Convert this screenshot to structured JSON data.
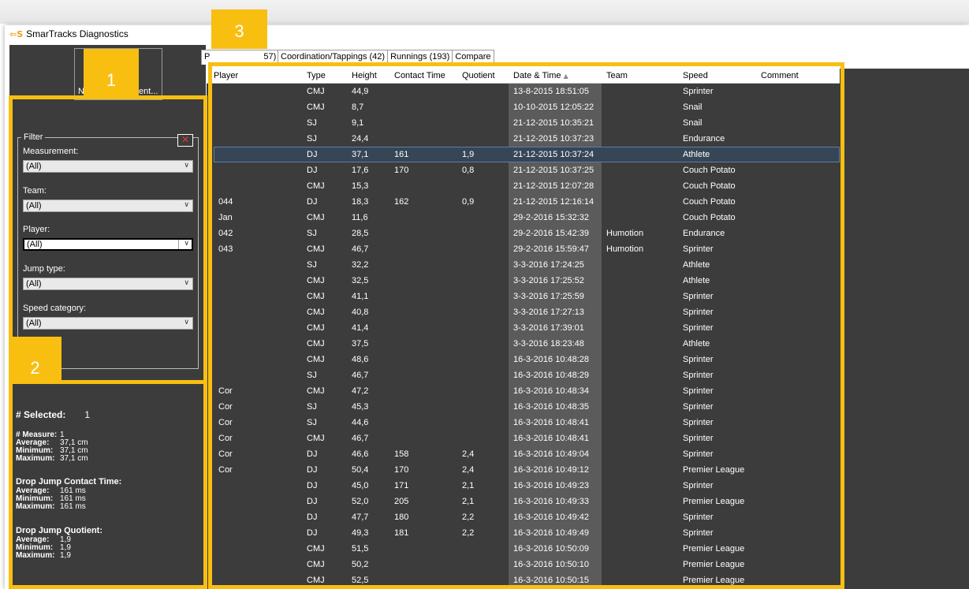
{
  "app": {
    "logo_text": "⇦S",
    "title": "SmarTracks Diagnostics"
  },
  "toolbar": {
    "new_measurement_label": "New measurement..."
  },
  "filter": {
    "legend": "Filter",
    "close_symbol": "✕",
    "measurement": {
      "label": "Measurement:",
      "value": "(All)"
    },
    "team": {
      "label": "Team:",
      "value": "(All)"
    },
    "player": {
      "label": "Player:",
      "value": "(All)"
    },
    "jump_type": {
      "label": "Jump type:",
      "value": "(All)"
    },
    "speed_category": {
      "label": "Speed category:",
      "value": "(All)"
    }
  },
  "stats": {
    "selected_label": "# Selected:",
    "selected_value": "1",
    "measure_label": "# Measure:",
    "measure_value": "1",
    "height": {
      "average_label": "Average:",
      "average": "37,1 cm",
      "minimum_label": "Minimum:",
      "minimum": "37,1 cm",
      "maximum_label": "Maximum:",
      "maximum": "37,1 cm"
    },
    "contact_title": "Drop Jump Contact Time:",
    "contact": {
      "average_label": "Average:",
      "average": "161 ms",
      "minimum_label": "Minimum:",
      "minimum": "161 ms",
      "maximum_label": "Maximum:",
      "maximum": "161 ms"
    },
    "quotient_title": "Drop Jump Quotient:",
    "quotient": {
      "average_label": "Average:",
      "average": "1,9",
      "minimum_label": "Minimum:",
      "minimum": "1,9",
      "maximum_label": "Maximum:",
      "maximum": "1,9"
    }
  },
  "tabs": [
    {
      "label": "P",
      "label_tail": "57)"
    },
    {
      "label": "Coordination/Tappings (42)"
    },
    {
      "label": "Runnings (193)"
    },
    {
      "label": "Compare"
    }
  ],
  "grid": {
    "columns": [
      "Player",
      "Type",
      "Height",
      "Contact Time",
      "Quotient",
      "Date & Time",
      "Team",
      "Speed",
      "Comment"
    ],
    "sort_indicator": "▲",
    "selected_row_index": 4,
    "rows": [
      [
        "",
        "CMJ",
        "44,9",
        "",
        "",
        "13-8-2015 18:51:05",
        "",
        "Sprinter",
        ""
      ],
      [
        "",
        "CMJ",
        "8,7",
        "",
        "",
        "10-10-2015 12:05:22",
        "",
        "Snail",
        ""
      ],
      [
        "",
        "SJ",
        "9,1",
        "",
        "",
        "21-12-2015 10:35:21",
        "",
        "Snail",
        ""
      ],
      [
        "",
        "SJ",
        "24,4",
        "",
        "",
        "21-12-2015 10:37:23",
        "",
        "Endurance",
        ""
      ],
      [
        "",
        "DJ",
        "37,1",
        "161",
        "1,9",
        "21-12-2015 10:37:24",
        "",
        "Athlete",
        ""
      ],
      [
        "",
        "DJ",
        "17,6",
        "170",
        "0,8",
        "21-12-2015 10:37:25",
        "",
        "Couch Potato",
        ""
      ],
      [
        "",
        "CMJ",
        "15,3",
        "",
        "",
        "21-12-2015 12:07:28",
        "",
        "Couch Potato",
        ""
      ],
      [
        "044",
        "DJ",
        "18,3",
        "162",
        "0,9",
        "21-12-2015 12:16:14",
        "",
        "Couch Potato",
        ""
      ],
      [
        "Jan",
        "CMJ",
        "11,6",
        "",
        "",
        "29-2-2016 15:32:32",
        "",
        "Couch Potato",
        ""
      ],
      [
        "042",
        "SJ",
        "28,5",
        "",
        "",
        "29-2-2016 15:42:39",
        "Humotion",
        "Endurance",
        ""
      ],
      [
        "043",
        "CMJ",
        "46,7",
        "",
        "",
        "29-2-2016 15:59:47",
        "Humotion",
        "Sprinter",
        ""
      ],
      [
        "",
        "SJ",
        "32,2",
        "",
        "",
        "3-3-2016 17:24:25",
        "",
        "Athlete",
        ""
      ],
      [
        "",
        "CMJ",
        "32,5",
        "",
        "",
        "3-3-2016 17:25:52",
        "",
        "Athlete",
        ""
      ],
      [
        "",
        "CMJ",
        "41,1",
        "",
        "",
        "3-3-2016 17:25:59",
        "",
        "Sprinter",
        ""
      ],
      [
        "",
        "CMJ",
        "40,8",
        "",
        "",
        "3-3-2016 17:27:13",
        "",
        "Sprinter",
        ""
      ],
      [
        "",
        "CMJ",
        "41,4",
        "",
        "",
        "3-3-2016 17:39:01",
        "",
        "Sprinter",
        ""
      ],
      [
        "",
        "CMJ",
        "37,5",
        "",
        "",
        "3-3-2016 18:23:48",
        "",
        "Athlete",
        ""
      ],
      [
        "",
        "CMJ",
        "48,6",
        "",
        "",
        "16-3-2016 10:48:28",
        "",
        "Sprinter",
        ""
      ],
      [
        "",
        "SJ",
        "46,7",
        "",
        "",
        "16-3-2016 10:48:29",
        "",
        "Sprinter",
        ""
      ],
      [
        "Cor",
        "CMJ",
        "47,2",
        "",
        "",
        "16-3-2016 10:48:34",
        "",
        "Sprinter",
        ""
      ],
      [
        "Cor",
        "SJ",
        "45,3",
        "",
        "",
        "16-3-2016 10:48:35",
        "",
        "Sprinter",
        ""
      ],
      [
        "Cor",
        "SJ",
        "44,6",
        "",
        "",
        "16-3-2016 10:48:41",
        "",
        "Sprinter",
        ""
      ],
      [
        "Cor",
        "CMJ",
        "46,7",
        "",
        "",
        "16-3-2016 10:48:41",
        "",
        "Sprinter",
        ""
      ],
      [
        "Cor",
        "DJ",
        "46,6",
        "158",
        "2,4",
        "16-3-2016 10:49:04",
        "",
        "Sprinter",
        ""
      ],
      [
        "Cor",
        "DJ",
        "50,4",
        "170",
        "2,4",
        "16-3-2016 10:49:12",
        "",
        "Premier League",
        ""
      ],
      [
        "",
        "DJ",
        "45,0",
        "171",
        "2,1",
        "16-3-2016 10:49:23",
        "",
        "Sprinter",
        ""
      ],
      [
        "",
        "DJ",
        "52,0",
        "205",
        "2,1",
        "16-3-2016 10:49:33",
        "",
        "Premier League",
        ""
      ],
      [
        "",
        "DJ",
        "47,7",
        "180",
        "2,2",
        "16-3-2016 10:49:42",
        "",
        "Sprinter",
        ""
      ],
      [
        "",
        "DJ",
        "49,3",
        "181",
        "2,2",
        "16-3-2016 10:49:49",
        "",
        "Sprinter",
        ""
      ],
      [
        "",
        "CMJ",
        "51,5",
        "",
        "",
        "16-3-2016 10:50:09",
        "",
        "Premier League",
        ""
      ],
      [
        "",
        "CMJ",
        "50,2",
        "",
        "",
        "16-3-2016 10:50:10",
        "",
        "Premier League",
        ""
      ],
      [
        "",
        "CMJ",
        "52,5",
        "",
        "",
        "16-3-2016 10:50:15",
        "",
        "Premier League",
        ""
      ]
    ]
  },
  "annotations": [
    {
      "label": "1"
    },
    {
      "label": "2"
    },
    {
      "label": "3"
    }
  ],
  "colors": {
    "accent": "#f8bf11",
    "panel": "#3c3c3c",
    "selected_row": "#364656",
    "logo": "#f29a1f"
  }
}
